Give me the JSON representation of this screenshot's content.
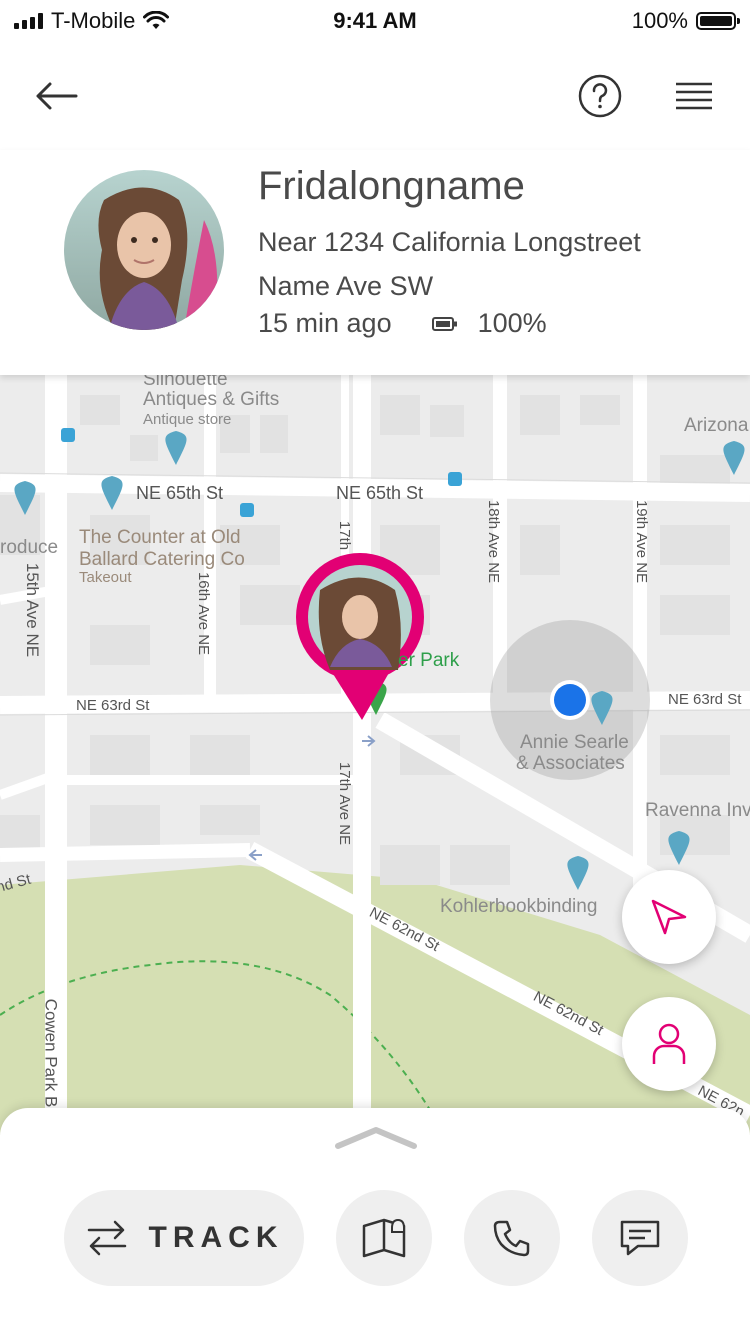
{
  "status_bar": {
    "carrier": "T-Mobile",
    "time": "9:41 AM",
    "battery": "100%"
  },
  "header": {
    "back_icon": "arrow-left-icon",
    "help_icon": "question-circle-icon",
    "menu_icon": "hamburger-menu-icon"
  },
  "profile": {
    "name": "Fridalongname",
    "address_line1": "Near 1234 California Longstreet",
    "address_line2": "Name Ave SW",
    "last_seen": "15 min ago",
    "battery": "100%"
  },
  "map": {
    "labels": {
      "silhouette": "Silhouette",
      "antiques": "Antiques & Gifts",
      "antique_store": "Antique store",
      "arizona": "Arizona",
      "ne65_left": "NE 65th St",
      "ne65_right": "NE 65th St",
      "produce": "roduce",
      "counter1": "The Counter at Old",
      "counter2": "Ballard Catering Co",
      "takeout": "Takeout",
      "ave15": "15th Ave NE",
      "ave16": "16th Ave NE",
      "ave17_top": "17th",
      "ave17_bottom": "17th Ave NE",
      "ave18": "18th Ave NE",
      "ave19": "19th Ave NE",
      "park": "er Park",
      "ne63_left": "NE 63rd St",
      "ne63_right": "NE 63rd St",
      "annie1": "Annie Searle",
      "annie2": "& Associates",
      "ravenna": "Ravenna Inv",
      "kohler": "Kohlerbookbinding",
      "nd_st": "nd St",
      "ne62_a": "NE 62nd St",
      "ne62_b": "NE 62nd St",
      "ne62_c": "NE 62n",
      "cowen": "Cowen Park B"
    },
    "accent_color": "#e20074",
    "user_dot_color": "#1a73e8"
  },
  "fabs": {
    "navigate_icon": "navigation-arrow-icon",
    "person_icon": "person-icon"
  },
  "bottom_sheet": {
    "track_label": "TRACK",
    "track_icon": "swap-arrows-icon",
    "diary_icon": "book-bell-icon",
    "call_icon": "phone-icon",
    "message_icon": "message-icon"
  }
}
